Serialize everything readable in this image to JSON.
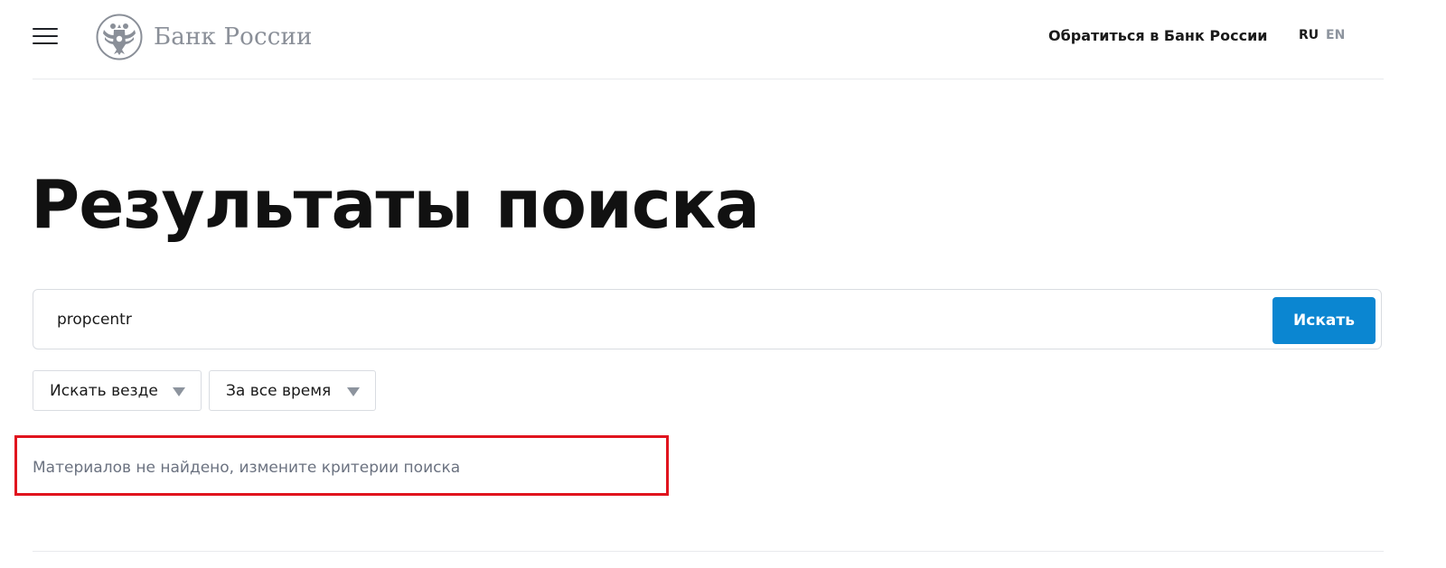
{
  "header": {
    "logo_text": "Банк России",
    "contact_link": "Обратиться в Банк России",
    "languages": [
      {
        "code": "RU",
        "active": true
      },
      {
        "code": "EN",
        "active": false
      }
    ]
  },
  "main": {
    "title": "Результаты поиска",
    "search": {
      "value": "propcentr",
      "placeholder": "",
      "button_label": "Искать"
    },
    "filters": [
      {
        "label": "Искать везде"
      },
      {
        "label": "За все время"
      }
    ],
    "empty_message": "Материалов не найдено, измените критерии поиска"
  },
  "colors": {
    "accent": "#0b86d1",
    "highlight": "#e0141e",
    "muted_text": "#6b7280",
    "logo_gray": "#8a8f98"
  },
  "icons": [
    "menu-icon",
    "bank-emblem-icon",
    "chevron-down-icon"
  ]
}
